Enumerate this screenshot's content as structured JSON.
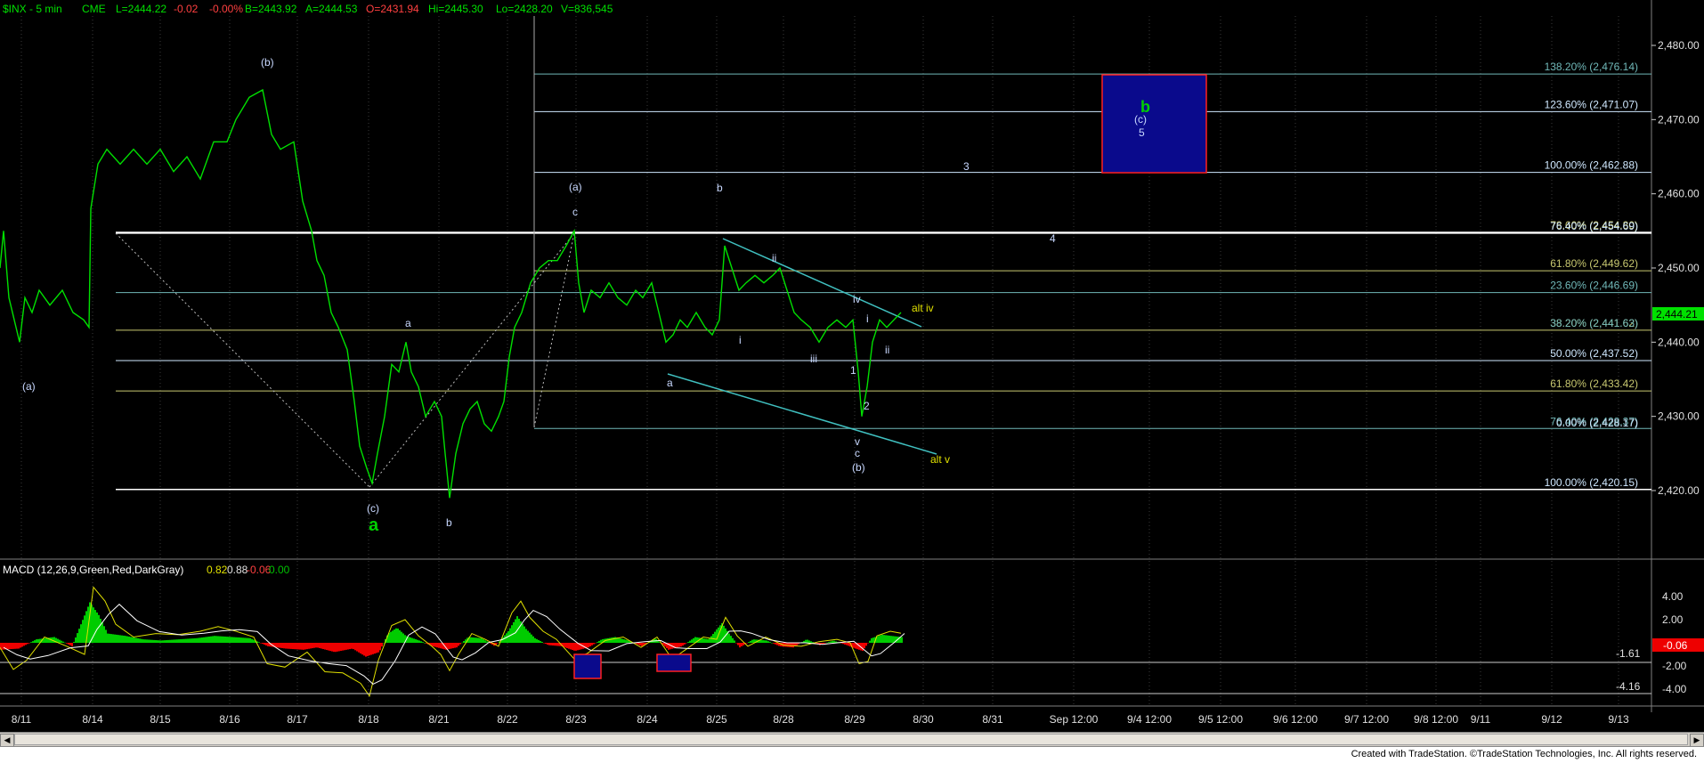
{
  "header": {
    "symbol": "$INX - 5 min",
    "exchange": "CME",
    "last": "L=2444.22",
    "change": "-0.02",
    "pct": "-0.00%",
    "bid": "B=2443.92",
    "ask": "A=2444.53",
    "open": "O=2431.94",
    "high": "Hi=2445.30",
    "low": "Lo=2428.20",
    "volume": "V=836,545"
  },
  "price_axis": {
    "ticks": [
      "2,480.00",
      "2,470.00",
      "2,460.00",
      "2,450.00",
      "2,440.00",
      "2,430.00",
      "2,420.00"
    ],
    "last_price_tag": "2,444.21"
  },
  "date_axis": {
    "labels": [
      "8/11",
      "8/14",
      "8/15",
      "8/16",
      "8/17",
      "8/18",
      "8/21",
      "8/22",
      "8/23",
      "8/24",
      "8/25",
      "8/28",
      "8/29",
      "8/30",
      "8/31",
      "Sep 12:00",
      "9/4 12:00",
      "9/5 12:00",
      "9/6 12:00",
      "9/7 12:00",
      "9/8 12:00",
      "9/11",
      "9/12",
      "9/13"
    ]
  },
  "fib_labels": [
    "138.20% (2,476.14)",
    "123.60% (2,471.07)",
    "100.00% (2,462.88)",
    "78.60% (2,454.80)",
    "76.40% (2,454.69)",
    "61.80% (2,449.62)",
    "23.60% (2,446.69)",
    "38.20% (2,441.62)",
    "38.20% (2,441.63)",
    "50.00% (2,437.52)",
    "61.80% (2,433.42)",
    "76.40% (2,428.37)",
    "0.00% (2,428.17)",
    "100.00% (2,420.15)"
  ],
  "wave_labels": {
    "a_left": "(a)",
    "b_top": "(b)",
    "c_low": "(c)",
    "big_a": "a",
    "small_a": "a",
    "small_b": "b",
    "paren_a": "(a)",
    "c_top": "c",
    "b_mid": "b",
    "ii_top": "ii",
    "i_low": "i",
    "iii": "iii",
    "iv": "iv",
    "a_low2": "a",
    "one": "1",
    "two": "2",
    "i_small": "i",
    "ii_small": "ii",
    "v": "v",
    "c_small": "c",
    "paren_b": "(b)",
    "alt_iv": "alt iv",
    "alt_v": "alt v",
    "three": "3",
    "four": "4",
    "box_b": "b",
    "box_c": "(c)",
    "box_5": "5"
  },
  "macd": {
    "title": "MACD (12,26,9,Green,Red,DarkGray)",
    "v1": "0.82",
    "v2": "0.88",
    "v3": "-0.06",
    "v4": "0.00",
    "ticks": [
      "4.00",
      "2.00",
      "-2.00",
      "-4.00"
    ],
    "last_tag": "-0.06",
    "level_1": "-1.61",
    "level_2": "-4.16"
  },
  "footer": {
    "credit": "Created with TradeStation. ©TradeStation Technologies, Inc. All rights reserved."
  },
  "colors": {
    "price": "#00e000",
    "fib_pale": "#cfe8ff",
    "fib_yellow": "#c8c870",
    "fib_teal": "#70b8b8",
    "target_box": "#0a0a8c",
    "target_border": "#ff2020",
    "macd_pos": "#00cc00",
    "macd_neg": "#ee0000",
    "label_yellow": "#e0e000",
    "label_green": "#00d000"
  },
  "chart_data": {
    "type": "line",
    "title": "$INX - 5 min",
    "ylim": [
      2414,
      2484
    ],
    "ytick_values": [
      2480,
      2470,
      2460,
      2450,
      2440,
      2430,
      2420
    ],
    "x": [
      "8/11",
      "8/14",
      "8/15",
      "8/16",
      "8/17",
      "8/18",
      "8/21",
      "8/22",
      "8/23",
      "8/24",
      "8/25",
      "8/28",
      "8/29",
      "8/29b"
    ],
    "series": [
      {
        "name": "$INX",
        "anchors": [
          [
            "8/11",
            2452
          ],
          [
            "8/11",
            2440
          ],
          [
            "8/11",
            2446
          ],
          [
            "8/11",
            2441
          ],
          [
            "8/14",
            2455
          ],
          [
            "8/14",
            2465
          ],
          [
            "8/15",
            2466
          ],
          [
            "8/15",
            2464
          ],
          [
            "8/16",
            2468
          ],
          [
            "8/16",
            2474
          ],
          [
            "8/17",
            2466
          ],
          [
            "8/17",
            2450
          ],
          [
            "8/18",
            2435
          ],
          [
            "8/18",
            2421
          ],
          [
            "8/18",
            2440
          ],
          [
            "8/21",
            2425
          ],
          [
            "8/21",
            2418
          ],
          [
            "8/21",
            2429
          ],
          [
            "8/22",
            2432
          ],
          [
            "8/22",
            2448
          ],
          [
            "8/23",
            2455
          ],
          [
            "8/23",
            2442
          ],
          [
            "8/24",
            2446
          ],
          [
            "8/24",
            2436
          ],
          [
            "8/25",
            2454
          ],
          [
            "8/25",
            2444
          ],
          [
            "8/28",
            2449
          ],
          [
            "8/28",
            2440
          ],
          [
            "8/29",
            2441
          ],
          [
            "8/29",
            2428
          ],
          [
            "8/29b",
            2444
          ]
        ]
      }
    ],
    "fib_levels": [
      2476.14,
      2471.07,
      2462.88,
      2454.8,
      2454.69,
      2449.62,
      2446.69,
      2441.62,
      2437.52,
      2433.42,
      2428.37,
      2420.15
    ],
    "target_box": {
      "low": 2462.88,
      "high": 2476.14
    },
    "macd_ylim": [
      -5,
      5
    ]
  }
}
